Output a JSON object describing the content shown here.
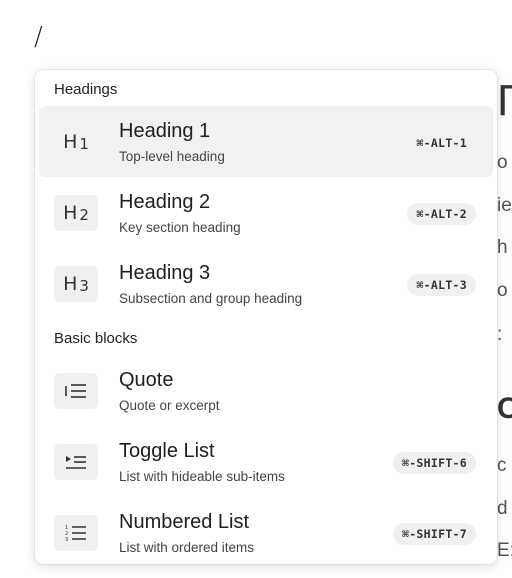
{
  "editor": {
    "slash": "/",
    "bg_lines": [
      "Γ",
      "o",
      "ie",
      "h",
      "o",
      ":",
      "C",
      "c",
      "d",
      "E:"
    ]
  },
  "menu": {
    "sections": [
      {
        "title": "Headings",
        "items": [
          {
            "icon": "H1",
            "title": "Heading 1",
            "desc": "Top-level heading",
            "shortcut": "⌘-ALT-1",
            "active": true
          },
          {
            "icon": "H2",
            "title": "Heading 2",
            "desc": "Key section heading",
            "shortcut": "⌘-ALT-2"
          },
          {
            "icon": "H3",
            "title": "Heading 3",
            "desc": "Subsection and group heading",
            "shortcut": "⌘-ALT-3"
          }
        ]
      },
      {
        "title": "Basic blocks",
        "items": [
          {
            "icon": "quote-icon",
            "title": "Quote",
            "desc": "Quote or excerpt",
            "shortcut": ""
          },
          {
            "icon": "toggle-list-icon",
            "title": "Toggle List",
            "desc": "List with hideable sub-items",
            "shortcut": "⌘-SHIFT-6"
          },
          {
            "icon": "numbered-list-icon",
            "title": "Numbered List",
            "desc": "List with ordered items",
            "shortcut": "⌘-SHIFT-7"
          }
        ]
      }
    ]
  }
}
